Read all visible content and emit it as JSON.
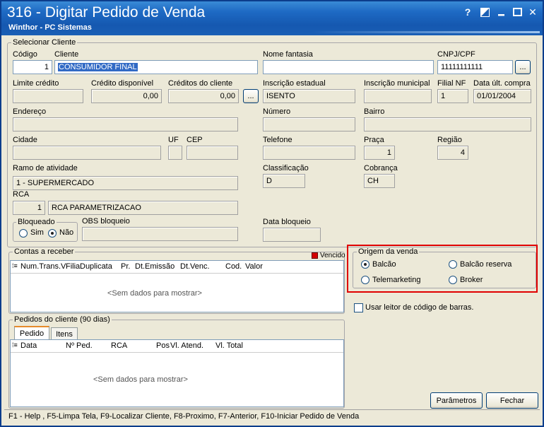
{
  "window": {
    "title": "316 - Digitar Pedido de Venda",
    "subtitle": "Winthor - PC Sistemas",
    "btn_help": "?",
    "btn_close": "✕"
  },
  "cliente": {
    "group_title": "Selecionar Cliente",
    "codigo_label": "Código",
    "codigo_value": "1",
    "cliente_label": "Cliente",
    "cliente_value": "CONSUMIDOR FINAL",
    "nome_fantasia_label": "Nome fantasia",
    "nome_fantasia_value": "",
    "cnpj_label": "CNPJ/CPF",
    "cnpj_value": "11111111111",
    "lookup_button": "...",
    "limite_label": "Limite crédito",
    "limite_value": "",
    "credito_disp_label": "Crédito disponível",
    "credito_disp_value": "0,00",
    "creditos_cli_label": "Créditos do cliente",
    "creditos_cli_value": "0,00",
    "insc_est_label": "Inscrição estadual",
    "insc_est_value": "ISENTO",
    "insc_mun_label": "Inscrição municipal",
    "insc_mun_value": "",
    "filial_label": "Filial NF",
    "filial_value": "1",
    "data_ult_label": "Data últ. compra",
    "data_ult_value": "01/01/2004",
    "endereco_label": "Endereço",
    "numero_label": "Número",
    "bairro_label": "Bairro",
    "cidade_label": "Cidade",
    "uf_label": "UF",
    "cep_label": "CEP",
    "telefone_label": "Telefone",
    "praca_label": "Praça",
    "praca_value": "1",
    "regiao_label": "Região",
    "regiao_value": "4",
    "ramo_label": "Ramo de atividade",
    "ramo_value": "1 - SUPERMERCADO",
    "classificacao_label": "Classificação",
    "classificacao_value": "D",
    "cobranca_label": "Cobrança",
    "cobranca_value": "CH",
    "rca_label": "RCA",
    "rca_code": "1",
    "rca_name": "RCA PARAMETRIZACAO",
    "bloqueado_label": "Bloqueado",
    "bloqueado_sim": "Sim",
    "bloqueado_nao": "Não",
    "obs_bloqueio_label": "OBS bloqueio",
    "data_bloqueio_label": "Data bloqueio"
  },
  "contas": {
    "group_title": "Contas a receber",
    "vencido_label": "Vencido",
    "vencido_color": "#d40000",
    "columns": [
      "Num.Trans.V",
      "Filia",
      "Duplicata",
      "Pr.",
      "Dt.Emissão",
      "Dt.Venc.",
      "Cod.",
      "Valor"
    ],
    "empty_text": "<Sem dados para mostrar>"
  },
  "origem": {
    "group_title": "Origem da venda",
    "options": [
      "Balcão",
      "Balcão reserva",
      "Telemarketing",
      "Broker"
    ],
    "selected": "Balcão",
    "highlight_color": "#e00000"
  },
  "leitor": {
    "label": "Usar leitor de código de barras."
  },
  "pedidos": {
    "group_title": "Pedidos do cliente (90 dias)",
    "tabs": [
      "Pedido",
      "Itens"
    ],
    "columns": [
      "Data",
      "Nº Ped.",
      "RCA",
      "Pos",
      "Vl. Atend.",
      "Vl. Total"
    ],
    "empty_text": "<Sem dados para mostrar>"
  },
  "buttons": {
    "parametros": "Parâmetros",
    "fechar": "Fechar"
  },
  "statusbar": {
    "text": "F1 - Help , F5-Limpa Tela, F9-Localizar Cliente, F8-Proximo, F7-Anterior, F10-Iniciar Pedido de Venda"
  }
}
